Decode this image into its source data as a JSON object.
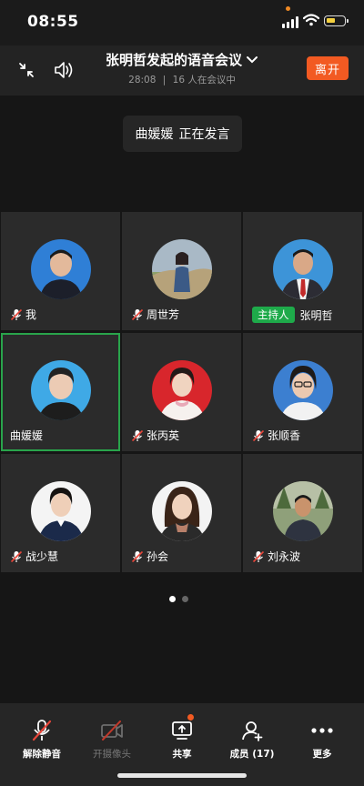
{
  "status_bar": {
    "time": "08:55"
  },
  "header": {
    "title": "张明哲发起的语音会议",
    "duration": "28:08",
    "separator": "|",
    "participants_text": "16 人在会议中",
    "leave_label": "离开"
  },
  "speaking": {
    "name": "曲媛媛",
    "status": "正在发言"
  },
  "participants": [
    {
      "name": "我",
      "muted": true,
      "host": false,
      "speaking": false
    },
    {
      "name": "周世芳",
      "muted": true,
      "host": false,
      "speaking": false
    },
    {
      "name": "张明哲",
      "muted": false,
      "host": true,
      "speaking": false
    },
    {
      "name": "曲媛媛",
      "muted": false,
      "host": false,
      "speaking": true
    },
    {
      "name": "张丙英",
      "muted": true,
      "host": false,
      "speaking": false
    },
    {
      "name": "张顺香",
      "muted": true,
      "host": false,
      "speaking": false
    },
    {
      "name": "战少慧",
      "muted": true,
      "host": false,
      "speaking": false
    },
    {
      "name": "孙会",
      "muted": true,
      "host": false,
      "speaking": false
    },
    {
      "name": "刘永波",
      "muted": true,
      "host": false,
      "speaking": false
    }
  ],
  "host_badge": "主持人",
  "pagination": {
    "pages": 2,
    "current": 1
  },
  "toolbar": {
    "unmute": "解除静音",
    "camera": "开摄像头",
    "share": "共享",
    "members": "成员 (17)",
    "more": "更多"
  },
  "colors": {
    "accent": "#f25a22",
    "host": "#1eaa4a",
    "active_border": "#29a44b"
  }
}
